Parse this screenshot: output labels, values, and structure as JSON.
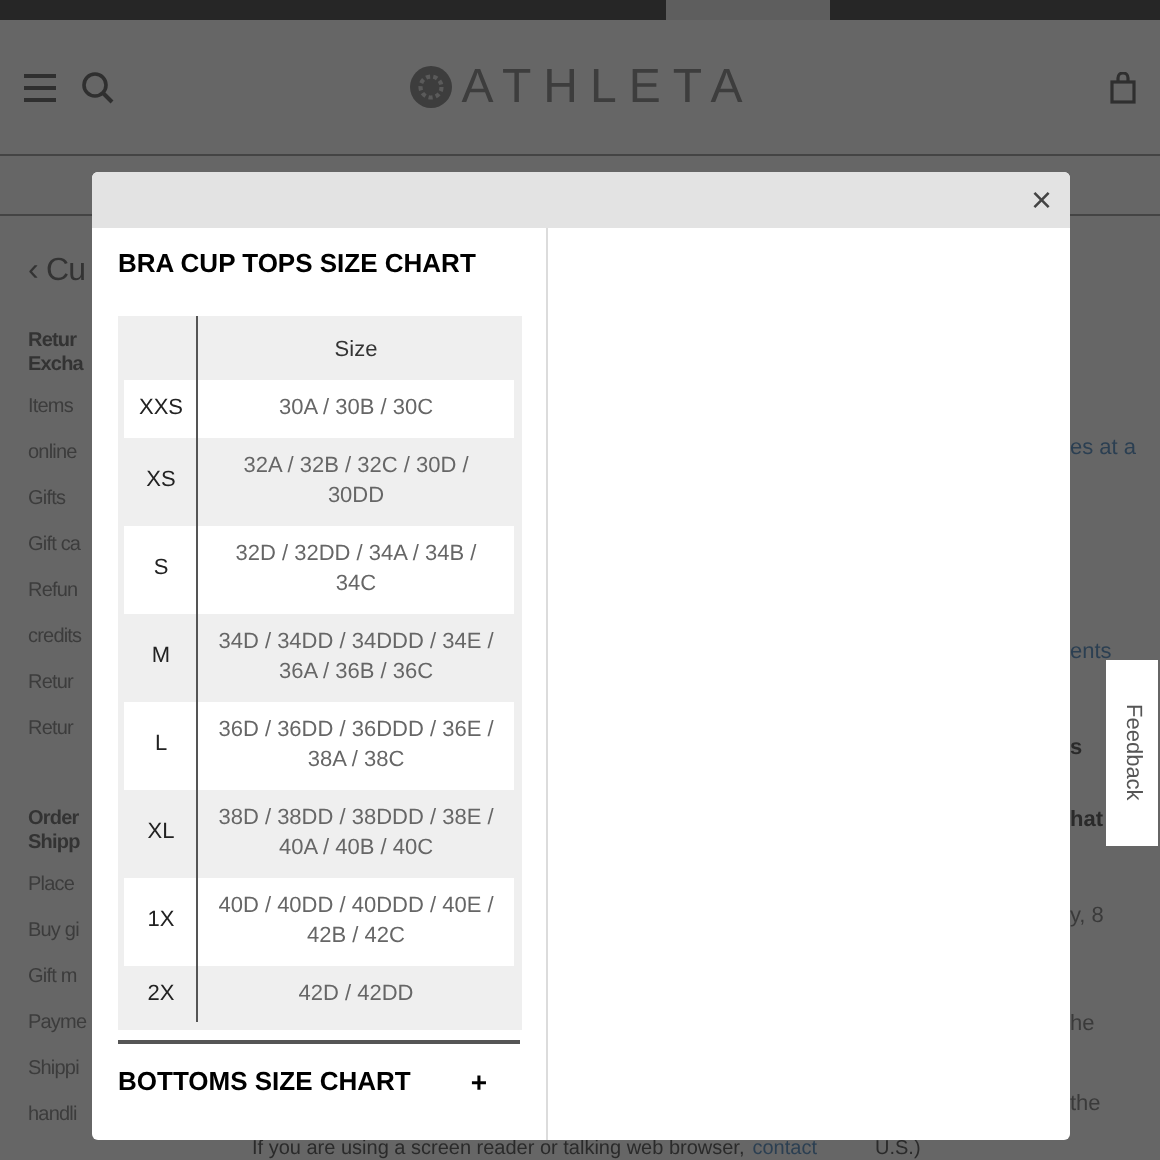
{
  "header": {
    "logo": "ATHLETA"
  },
  "background": {
    "back_link": "‹ Cu",
    "left_items": [
      {
        "text": "Retur\nExcha",
        "kind": "heading"
      },
      {
        "text": "Items",
        "kind": "item"
      },
      {
        "text": "online",
        "kind": "item"
      },
      {
        "text": "Gifts",
        "kind": "item"
      },
      {
        "text": "Gift ca",
        "kind": "item"
      },
      {
        "text": "Refun",
        "kind": "item"
      },
      {
        "text": "credits",
        "kind": "item"
      },
      {
        "text": "Retur",
        "kind": "item"
      },
      {
        "text": "Retur",
        "kind": "item"
      },
      {
        "text": "Order\nShipp",
        "kind": "heading"
      },
      {
        "text": "Place",
        "kind": "item"
      },
      {
        "text": "Buy gi",
        "kind": "item"
      },
      {
        "text": "Gift m",
        "kind": "item"
      },
      {
        "text": "Payme",
        "kind": "item"
      },
      {
        "text": "Shippi",
        "kind": "item"
      },
      {
        "text": "handli",
        "kind": "item"
      }
    ],
    "right_items": [
      {
        "text": "es at a",
        "kind": "link"
      },
      {
        "text": "ents",
        "kind": "link"
      },
      {
        "text": "s",
        "kind": "heading"
      },
      {
        "text": "hat",
        "kind": "heading"
      },
      {
        "text": "y, 8",
        "kind": "item"
      },
      {
        "text": "he",
        "kind": "item"
      },
      {
        "text": "the",
        "kind": "item"
      }
    ],
    "footer_text": "If you are using a screen reader or talking web browser,",
    "footer_link": "contact",
    "footer_tail": "U.S.)"
  },
  "feedback_tab": "Feedback",
  "modal": {
    "close": "×",
    "title": "BRA CUP TOPS SIZE CHART",
    "column_header": "Size",
    "rows": [
      {
        "size": "XXS",
        "values": "30A / 30B / 30C"
      },
      {
        "size": "XS",
        "values": "32A / 32B / 32C / 30D / 30DD"
      },
      {
        "size": "S",
        "values": "32D / 32DD / 34A / 34B / 34C"
      },
      {
        "size": "M",
        "values": "34D / 34DD / 34DDD / 34E / 36A / 36B / 36C"
      },
      {
        "size": "L",
        "values": "36D / 36DD / 36DDD / 36E / 38A / 38C"
      },
      {
        "size": "XL",
        "values": "38D / 38DD / 38DDD / 38E / 40A / 40B / 40C"
      },
      {
        "size": "1X",
        "values": "40D / 40DD / 40DDD / 40E / 42B / 42C"
      },
      {
        "size": "2X",
        "values": "42D / 42DD"
      }
    ],
    "section": {
      "title": "BOTTOMS SIZE CHART",
      "toggle": "+"
    }
  }
}
